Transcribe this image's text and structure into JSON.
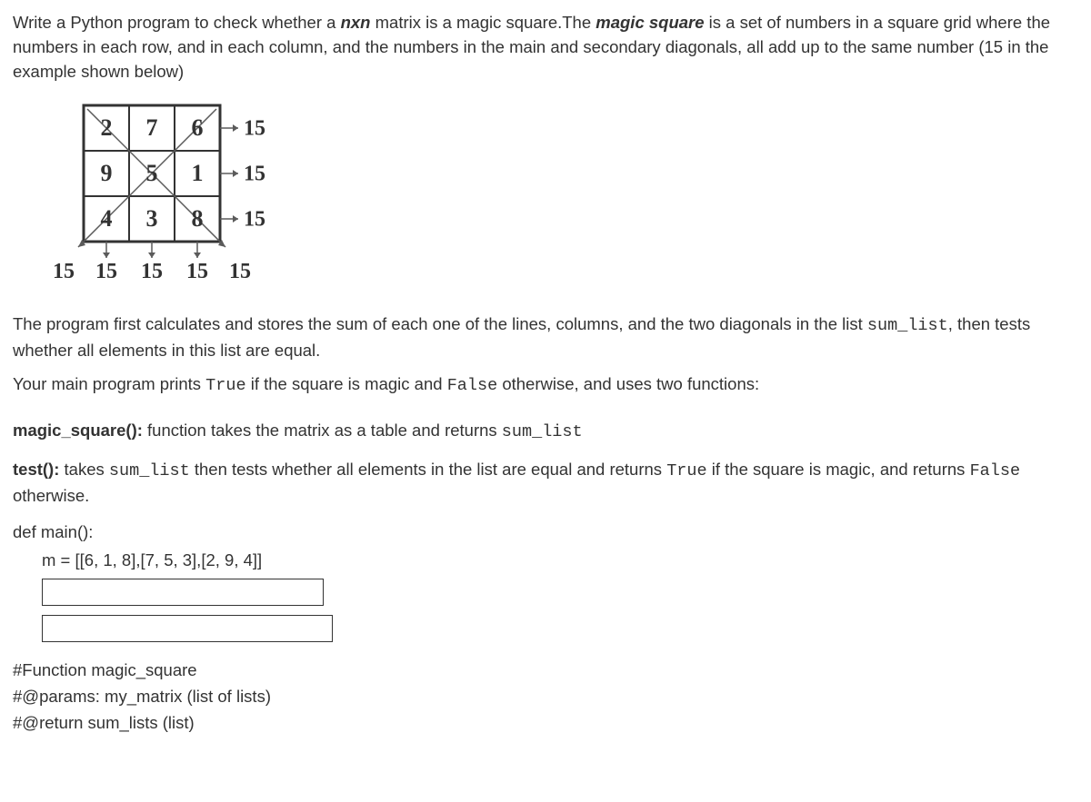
{
  "intro": {
    "line1a": "Write a Python program  to check  whether a ",
    "line1b": "nxn",
    "line1c": "  matrix is a magic square.The ",
    "line1d": "magic square",
    "line1e": " is a set of numbers in a square grid where the numbers in each row, and in each column, and the numbers in the main and secondary diagonals, all add up to the same number (15 in the example shown below)"
  },
  "grid": {
    "cells": [
      [
        "2",
        "7",
        "6"
      ],
      [
        "9",
        "5",
        "1"
      ],
      [
        "4",
        "3",
        "8"
      ]
    ],
    "rowSums": [
      "15",
      "15",
      "15"
    ],
    "colSums": [
      "15",
      "15",
      "15"
    ],
    "diagSums": [
      "15",
      "15"
    ]
  },
  "paragraph2a": "The program first calculates and stores the sum of each one of the lines, columns, and the two diagonals in the list ",
  "paragraph2b": "sum_list",
  "paragraph2c": ", then tests whether all elements in this list are equal.",
  "paragraph3a": "Your main program prints ",
  "paragraph3b": "True",
  "paragraph3c": " if the square is magic and ",
  "paragraph3d": "False",
  "paragraph3e": " otherwise, and uses two functions:",
  "funcs": {
    "f1a": "magic_square():",
    "f1b": "  function takes the matrix as a table and returns ",
    "f1c": "sum_list",
    "f2a": "test():",
    "f2b": " takes ",
    "f2c": "sum_list",
    "f2d": " then tests whether all elements in the list are equal and returns ",
    "f2e": "True",
    "f2f": " if the square is magic, and returns ",
    "f2g": "False",
    "f2h": " otherwise."
  },
  "code": {
    "def": "def main():",
    "assign": "m = [[6, 1, 8],[7, 5, 3],[2, 9, 4]]"
  },
  "comments": {
    "c1": "#Function magic_square",
    "c2": "#@params: my_matrix (list of lists)",
    "c3": "#@return sum_lists (list)"
  }
}
